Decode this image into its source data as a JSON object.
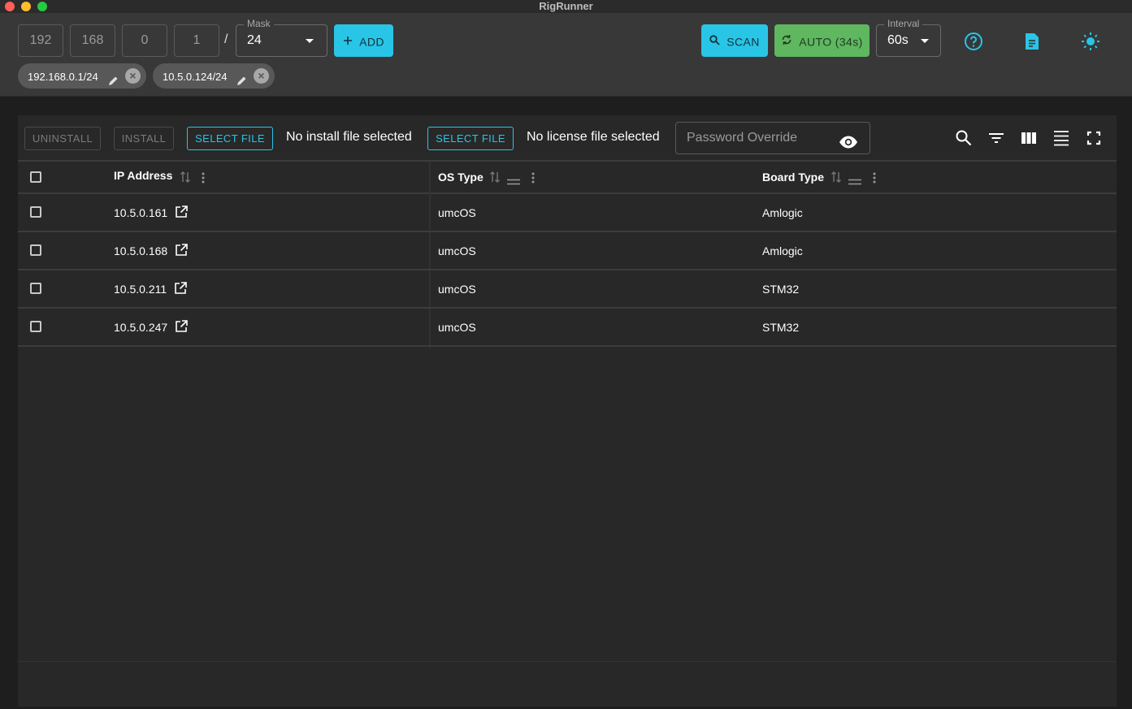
{
  "window": {
    "title": "RigRunner"
  },
  "toolbar": {
    "octets": [
      "192",
      "168",
      "0",
      "1"
    ],
    "slash": "/",
    "mask": {
      "label": "Mask",
      "value": "24"
    },
    "add_label": "ADD",
    "scan_label": "SCAN",
    "auto_label": "AUTO (34s)",
    "interval": {
      "label": "Interval",
      "value": "60s"
    }
  },
  "chips": [
    {
      "label": "192.168.0.1/24"
    },
    {
      "label": "10.5.0.124/24"
    }
  ],
  "actions": {
    "uninstall": "UNINSTALL",
    "install": "INSTALL",
    "select_install_file": "SELECT FILE",
    "install_file_status": "No install file selected",
    "select_license_file": "SELECT FILE",
    "license_file_status": "No license file selected",
    "password_placeholder": "Password Override"
  },
  "table": {
    "columns": [
      "IP Address",
      "OS Type",
      "Board Type"
    ],
    "rows": [
      {
        "ip": "10.5.0.161",
        "os": "umcOS",
        "board": "Amlogic"
      },
      {
        "ip": "10.5.0.168",
        "os": "umcOS",
        "board": "Amlogic"
      },
      {
        "ip": "10.5.0.211",
        "os": "umcOS",
        "board": "STM32"
      },
      {
        "ip": "10.5.0.247",
        "os": "umcOS",
        "board": "STM32"
      }
    ]
  },
  "colors": {
    "accent": "#29c5e6",
    "auto_green": "#5fb760",
    "background": "#1e1e1e",
    "panel": "#282828",
    "toolbar": "#383838"
  },
  "icons": [
    "search-icon",
    "sync-icon",
    "plus-icon",
    "help-icon",
    "document-icon",
    "brightness-icon",
    "pencil-icon",
    "close-icon",
    "eye-icon",
    "filter-icon",
    "columns-icon",
    "density-icon",
    "fullscreen-icon",
    "sort-icon",
    "column-menu-icon",
    "drag-handle-icon",
    "open-external-icon",
    "checkbox"
  ]
}
